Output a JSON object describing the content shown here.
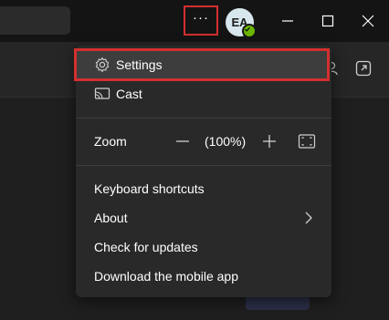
{
  "titlebar": {
    "more_options_label": "···",
    "avatar_initials": "EA"
  },
  "menu": {
    "settings_label": "Settings",
    "cast_label": "Cast",
    "zoom": {
      "label": "Zoom",
      "value": "(100%)"
    },
    "keyboard_shortcuts_label": "Keyboard shortcuts",
    "about_label": "About",
    "check_updates_label": "Check for updates",
    "download_mobile_label": "Download the mobile app"
  },
  "colors": {
    "highlight_border": "#d32f2f",
    "presence": "#6bb700",
    "menu_bg": "#292929"
  },
  "icons": [
    "gear-icon",
    "cast-icon",
    "zoom-out-icon",
    "zoom-in-icon",
    "fit-screen-icon",
    "chevron-right-icon",
    "more-options-icon"
  ]
}
